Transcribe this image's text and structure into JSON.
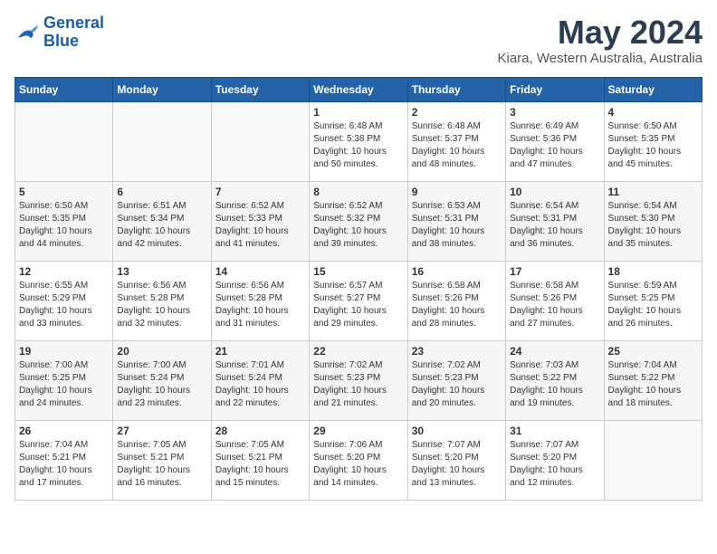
{
  "header": {
    "logo_line1": "General",
    "logo_line2": "Blue",
    "title": "May 2024",
    "subtitle": "Kiara, Western Australia, Australia"
  },
  "days_of_week": [
    "Sunday",
    "Monday",
    "Tuesday",
    "Wednesday",
    "Thursday",
    "Friday",
    "Saturday"
  ],
  "weeks": [
    [
      {
        "num": "",
        "info": ""
      },
      {
        "num": "",
        "info": ""
      },
      {
        "num": "",
        "info": ""
      },
      {
        "num": "1",
        "info": "Sunrise: 6:48 AM\nSunset: 5:38 PM\nDaylight: 10 hours\nand 50 minutes."
      },
      {
        "num": "2",
        "info": "Sunrise: 6:48 AM\nSunset: 5:37 PM\nDaylight: 10 hours\nand 48 minutes."
      },
      {
        "num": "3",
        "info": "Sunrise: 6:49 AM\nSunset: 5:36 PM\nDaylight: 10 hours\nand 47 minutes."
      },
      {
        "num": "4",
        "info": "Sunrise: 6:50 AM\nSunset: 5:35 PM\nDaylight: 10 hours\nand 45 minutes."
      }
    ],
    [
      {
        "num": "5",
        "info": "Sunrise: 6:50 AM\nSunset: 5:35 PM\nDaylight: 10 hours\nand 44 minutes."
      },
      {
        "num": "6",
        "info": "Sunrise: 6:51 AM\nSunset: 5:34 PM\nDaylight: 10 hours\nand 42 minutes."
      },
      {
        "num": "7",
        "info": "Sunrise: 6:52 AM\nSunset: 5:33 PM\nDaylight: 10 hours\nand 41 minutes."
      },
      {
        "num": "8",
        "info": "Sunrise: 6:52 AM\nSunset: 5:32 PM\nDaylight: 10 hours\nand 39 minutes."
      },
      {
        "num": "9",
        "info": "Sunrise: 6:53 AM\nSunset: 5:31 PM\nDaylight: 10 hours\nand 38 minutes."
      },
      {
        "num": "10",
        "info": "Sunrise: 6:54 AM\nSunset: 5:31 PM\nDaylight: 10 hours\nand 36 minutes."
      },
      {
        "num": "11",
        "info": "Sunrise: 6:54 AM\nSunset: 5:30 PM\nDaylight: 10 hours\nand 35 minutes."
      }
    ],
    [
      {
        "num": "12",
        "info": "Sunrise: 6:55 AM\nSunset: 5:29 PM\nDaylight: 10 hours\nand 33 minutes."
      },
      {
        "num": "13",
        "info": "Sunrise: 6:56 AM\nSunset: 5:28 PM\nDaylight: 10 hours\nand 32 minutes."
      },
      {
        "num": "14",
        "info": "Sunrise: 6:56 AM\nSunset: 5:28 PM\nDaylight: 10 hours\nand 31 minutes."
      },
      {
        "num": "15",
        "info": "Sunrise: 6:57 AM\nSunset: 5:27 PM\nDaylight: 10 hours\nand 29 minutes."
      },
      {
        "num": "16",
        "info": "Sunrise: 6:58 AM\nSunset: 5:26 PM\nDaylight: 10 hours\nand 28 minutes."
      },
      {
        "num": "17",
        "info": "Sunrise: 6:58 AM\nSunset: 5:26 PM\nDaylight: 10 hours\nand 27 minutes."
      },
      {
        "num": "18",
        "info": "Sunrise: 6:59 AM\nSunset: 5:25 PM\nDaylight: 10 hours\nand 26 minutes."
      }
    ],
    [
      {
        "num": "19",
        "info": "Sunrise: 7:00 AM\nSunset: 5:25 PM\nDaylight: 10 hours\nand 24 minutes."
      },
      {
        "num": "20",
        "info": "Sunrise: 7:00 AM\nSunset: 5:24 PM\nDaylight: 10 hours\nand 23 minutes."
      },
      {
        "num": "21",
        "info": "Sunrise: 7:01 AM\nSunset: 5:24 PM\nDaylight: 10 hours\nand 22 minutes."
      },
      {
        "num": "22",
        "info": "Sunrise: 7:02 AM\nSunset: 5:23 PM\nDaylight: 10 hours\nand 21 minutes."
      },
      {
        "num": "23",
        "info": "Sunrise: 7:02 AM\nSunset: 5:23 PM\nDaylight: 10 hours\nand 20 minutes."
      },
      {
        "num": "24",
        "info": "Sunrise: 7:03 AM\nSunset: 5:22 PM\nDaylight: 10 hours\nand 19 minutes."
      },
      {
        "num": "25",
        "info": "Sunrise: 7:04 AM\nSunset: 5:22 PM\nDaylight: 10 hours\nand 18 minutes."
      }
    ],
    [
      {
        "num": "26",
        "info": "Sunrise: 7:04 AM\nSunset: 5:21 PM\nDaylight: 10 hours\nand 17 minutes."
      },
      {
        "num": "27",
        "info": "Sunrise: 7:05 AM\nSunset: 5:21 PM\nDaylight: 10 hours\nand 16 minutes."
      },
      {
        "num": "28",
        "info": "Sunrise: 7:05 AM\nSunset: 5:21 PM\nDaylight: 10 hours\nand 15 minutes."
      },
      {
        "num": "29",
        "info": "Sunrise: 7:06 AM\nSunset: 5:20 PM\nDaylight: 10 hours\nand 14 minutes."
      },
      {
        "num": "30",
        "info": "Sunrise: 7:07 AM\nSunset: 5:20 PM\nDaylight: 10 hours\nand 13 minutes."
      },
      {
        "num": "31",
        "info": "Sunrise: 7:07 AM\nSunset: 5:20 PM\nDaylight: 10 hours\nand 12 minutes."
      },
      {
        "num": "",
        "info": ""
      }
    ]
  ]
}
